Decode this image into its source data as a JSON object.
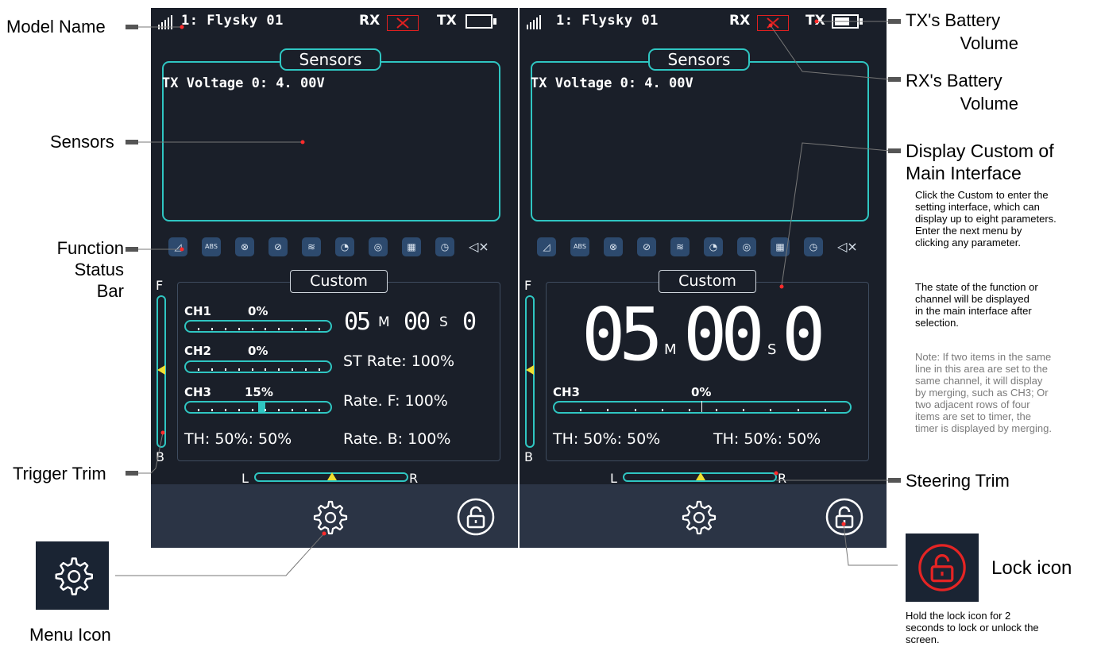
{
  "screen_left": {
    "model_name": "1: Flysky 01",
    "rx_label": "RX",
    "tx_label": "TX",
    "sensors_title": "Sensors",
    "tx_voltage": "TX Voltage 0: 4. 00V",
    "function_icons": [
      "brake-icon",
      "abs-icon",
      "throttle-icon",
      "compass-icon",
      "boat-icon",
      "gyro-icon",
      "wheel-icon",
      "mixer-icon",
      "timer-icon",
      "mute-icon"
    ],
    "function_icon_glyphs": [
      "◿",
      "ABS",
      "⊗",
      "⊘",
      "≋",
      "◔",
      "◎",
      "▦",
      "◷",
      "◁×"
    ],
    "custom_title": "Custom",
    "trim_top_label": "F",
    "trim_bottom_label": "B",
    "channels": [
      {
        "name": "CH1",
        "value": "0%",
        "fill": 0
      },
      {
        "name": "CH2",
        "value": "0%",
        "fill": 0
      },
      {
        "name": "CH3",
        "value": "15%",
        "fill": 0.15
      }
    ],
    "timer_min": "05",
    "timer_min_unit": "M",
    "timer_sec": "00",
    "timer_sec_unit": "S",
    "timer_tenth": "0",
    "st_rate": "ST Rate: 100%",
    "rate_f": "Rate. F: 100%",
    "rate_b": "Rate. B: 100%",
    "th_rate": "TH: 50%: 50%",
    "steer_left": "L",
    "steer_right": "R"
  },
  "screen_right": {
    "model_name": "1: Flysky 01",
    "rx_label": "RX",
    "tx_label": "TX",
    "sensors_title": "Sensors",
    "tx_voltage": "TX Voltage 0: 4. 00V",
    "custom_title": "Custom",
    "trim_top_label": "F",
    "trim_bottom_label": "B",
    "timer_min": "05",
    "timer_min_unit": "M",
    "timer_sec": "00",
    "timer_sec_unit": "S",
    "timer_tenth": "0",
    "ch3_name": "CH3",
    "ch3_value": "0%",
    "th_rate_1": "TH: 50%: 50%",
    "th_rate_2": "TH: 50%: 50%",
    "steer_left": "L",
    "steer_right": "R"
  },
  "annotations": {
    "model_name": "Model Name",
    "sensors": "Sensors",
    "function_status_bar_1": "Function",
    "function_status_bar_2": "Status Bar",
    "trigger_trim": "Trigger Trim",
    "menu_icon": "Menu Icon",
    "tx_battery_1": "TX's Battery",
    "tx_battery_2": "Volume",
    "rx_battery_1": "RX's Battery",
    "rx_battery_2": "Volume",
    "display_custom_1": "Display Custom of",
    "display_custom_2": "Main Interface",
    "custom_desc": [
      "Click the Custom to enter the",
      "setting interface, which can",
      "display up to eight parameters.",
      "Enter the next menu by",
      "clicking any parameter."
    ],
    "state_desc": [
      "The state of the function or",
      "channel will be displayed",
      "in the main interface after",
      "selection."
    ],
    "note_desc": [
      "Note: If two items in the same",
      "line in this area are set to the",
      "same channel, it will display",
      "by merging, such as CH3; Or",
      "two adjacent rows of four",
      "items are set to timer, the",
      "timer is displayed by merging."
    ],
    "steering_trim": "Steering Trim",
    "lock_icon": "Lock icon",
    "lock_desc": [
      "Hold the lock icon for 2",
      "seconds to lock or unlock the",
      "screen."
    ]
  },
  "colors": {
    "screen_bg": "#1a1f29",
    "accent_cyan": "#2fc6c2",
    "alert_red": "#e02020",
    "bottom_bar": "#2b3445",
    "trim_marker": "#f0e030"
  }
}
